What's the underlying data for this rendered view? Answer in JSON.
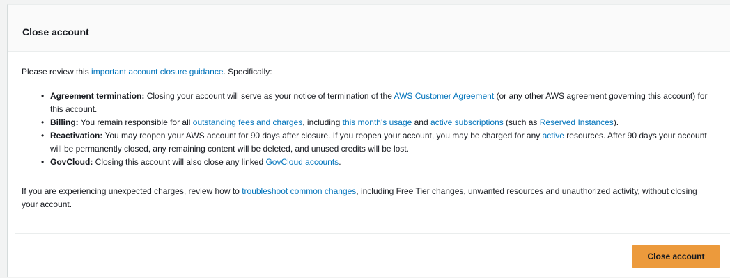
{
  "panel": {
    "title": "Close account"
  },
  "intro": {
    "prefix": "Please review this ",
    "link": "important account closure guidance",
    "suffix": ". Specifically:"
  },
  "points": [
    {
      "label": "Agreement termination:",
      "parts": [
        " Closing your account will serve as your notice of termination of the ",
        "AWS Customer Agreement",
        " (or any other AWS agreement governing this account) for this account."
      ]
    },
    {
      "label": "Billing:",
      "parts": [
        " You remain responsible for all ",
        "outstanding fees and charges",
        ", including ",
        "this month's usage",
        " and ",
        "active subscriptions",
        " (such as ",
        "Reserved Instances",
        ")."
      ]
    },
    {
      "label": "Reactivation:",
      "parts": [
        " You may reopen your AWS account for 90 days after closure. If you reopen your account, you may be charged for any ",
        "active",
        " resources. After 90 days your account will be permanently closed, any remaining content will be deleted, and unused credits will be lost."
      ]
    },
    {
      "label": "GovCloud:",
      "parts": [
        " Closing this account will also close any linked ",
        "GovCloud accounts",
        "."
      ]
    }
  ],
  "bullet_glyph": "•",
  "outro": {
    "prefix": "If you are experiencing unexpected charges, review how to ",
    "link": "troubleshoot common changes",
    "suffix": ", including Free Tier changes, unwanted resources and unauthorized activity, without closing your account."
  },
  "footer": {
    "button_label": "Close account"
  },
  "colors": {
    "link": "#0073bb",
    "primary_button": "#ec9a3c",
    "header_bg": "#fafafa",
    "page_bg": "#f2f3f3"
  }
}
